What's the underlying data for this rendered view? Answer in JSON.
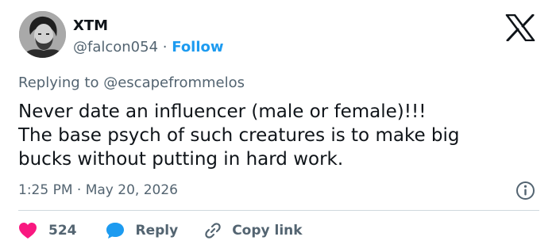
{
  "author": {
    "display_name": "XTM",
    "handle": "@falcon054",
    "separator": "·",
    "follow_label": "Follow"
  },
  "reply_context": {
    "prefix": "Replying to",
    "mention": "@escapefrommelos"
  },
  "tweet": {
    "lines": [
      "Never date an influencer (male or female)!!!",
      "The base psych of such creatures is to make big",
      "bucks without putting in hard work."
    ],
    "time": "1:25 PM",
    "separator": "·",
    "date": "May 20, 2026"
  },
  "actions": {
    "like_count": "524",
    "reply_label": "Reply",
    "copy_link_label": "Copy link"
  },
  "icons": {
    "logo": "x-logo-icon",
    "info": "info-icon",
    "like": "heart-icon",
    "reply": "speech-bubble-icon",
    "copy": "link-icon"
  },
  "colors": {
    "text": "#0f1419",
    "secondary": "#536471",
    "accent": "#1d9bf0",
    "like": "#f91880",
    "divider": "#cfd9de"
  }
}
